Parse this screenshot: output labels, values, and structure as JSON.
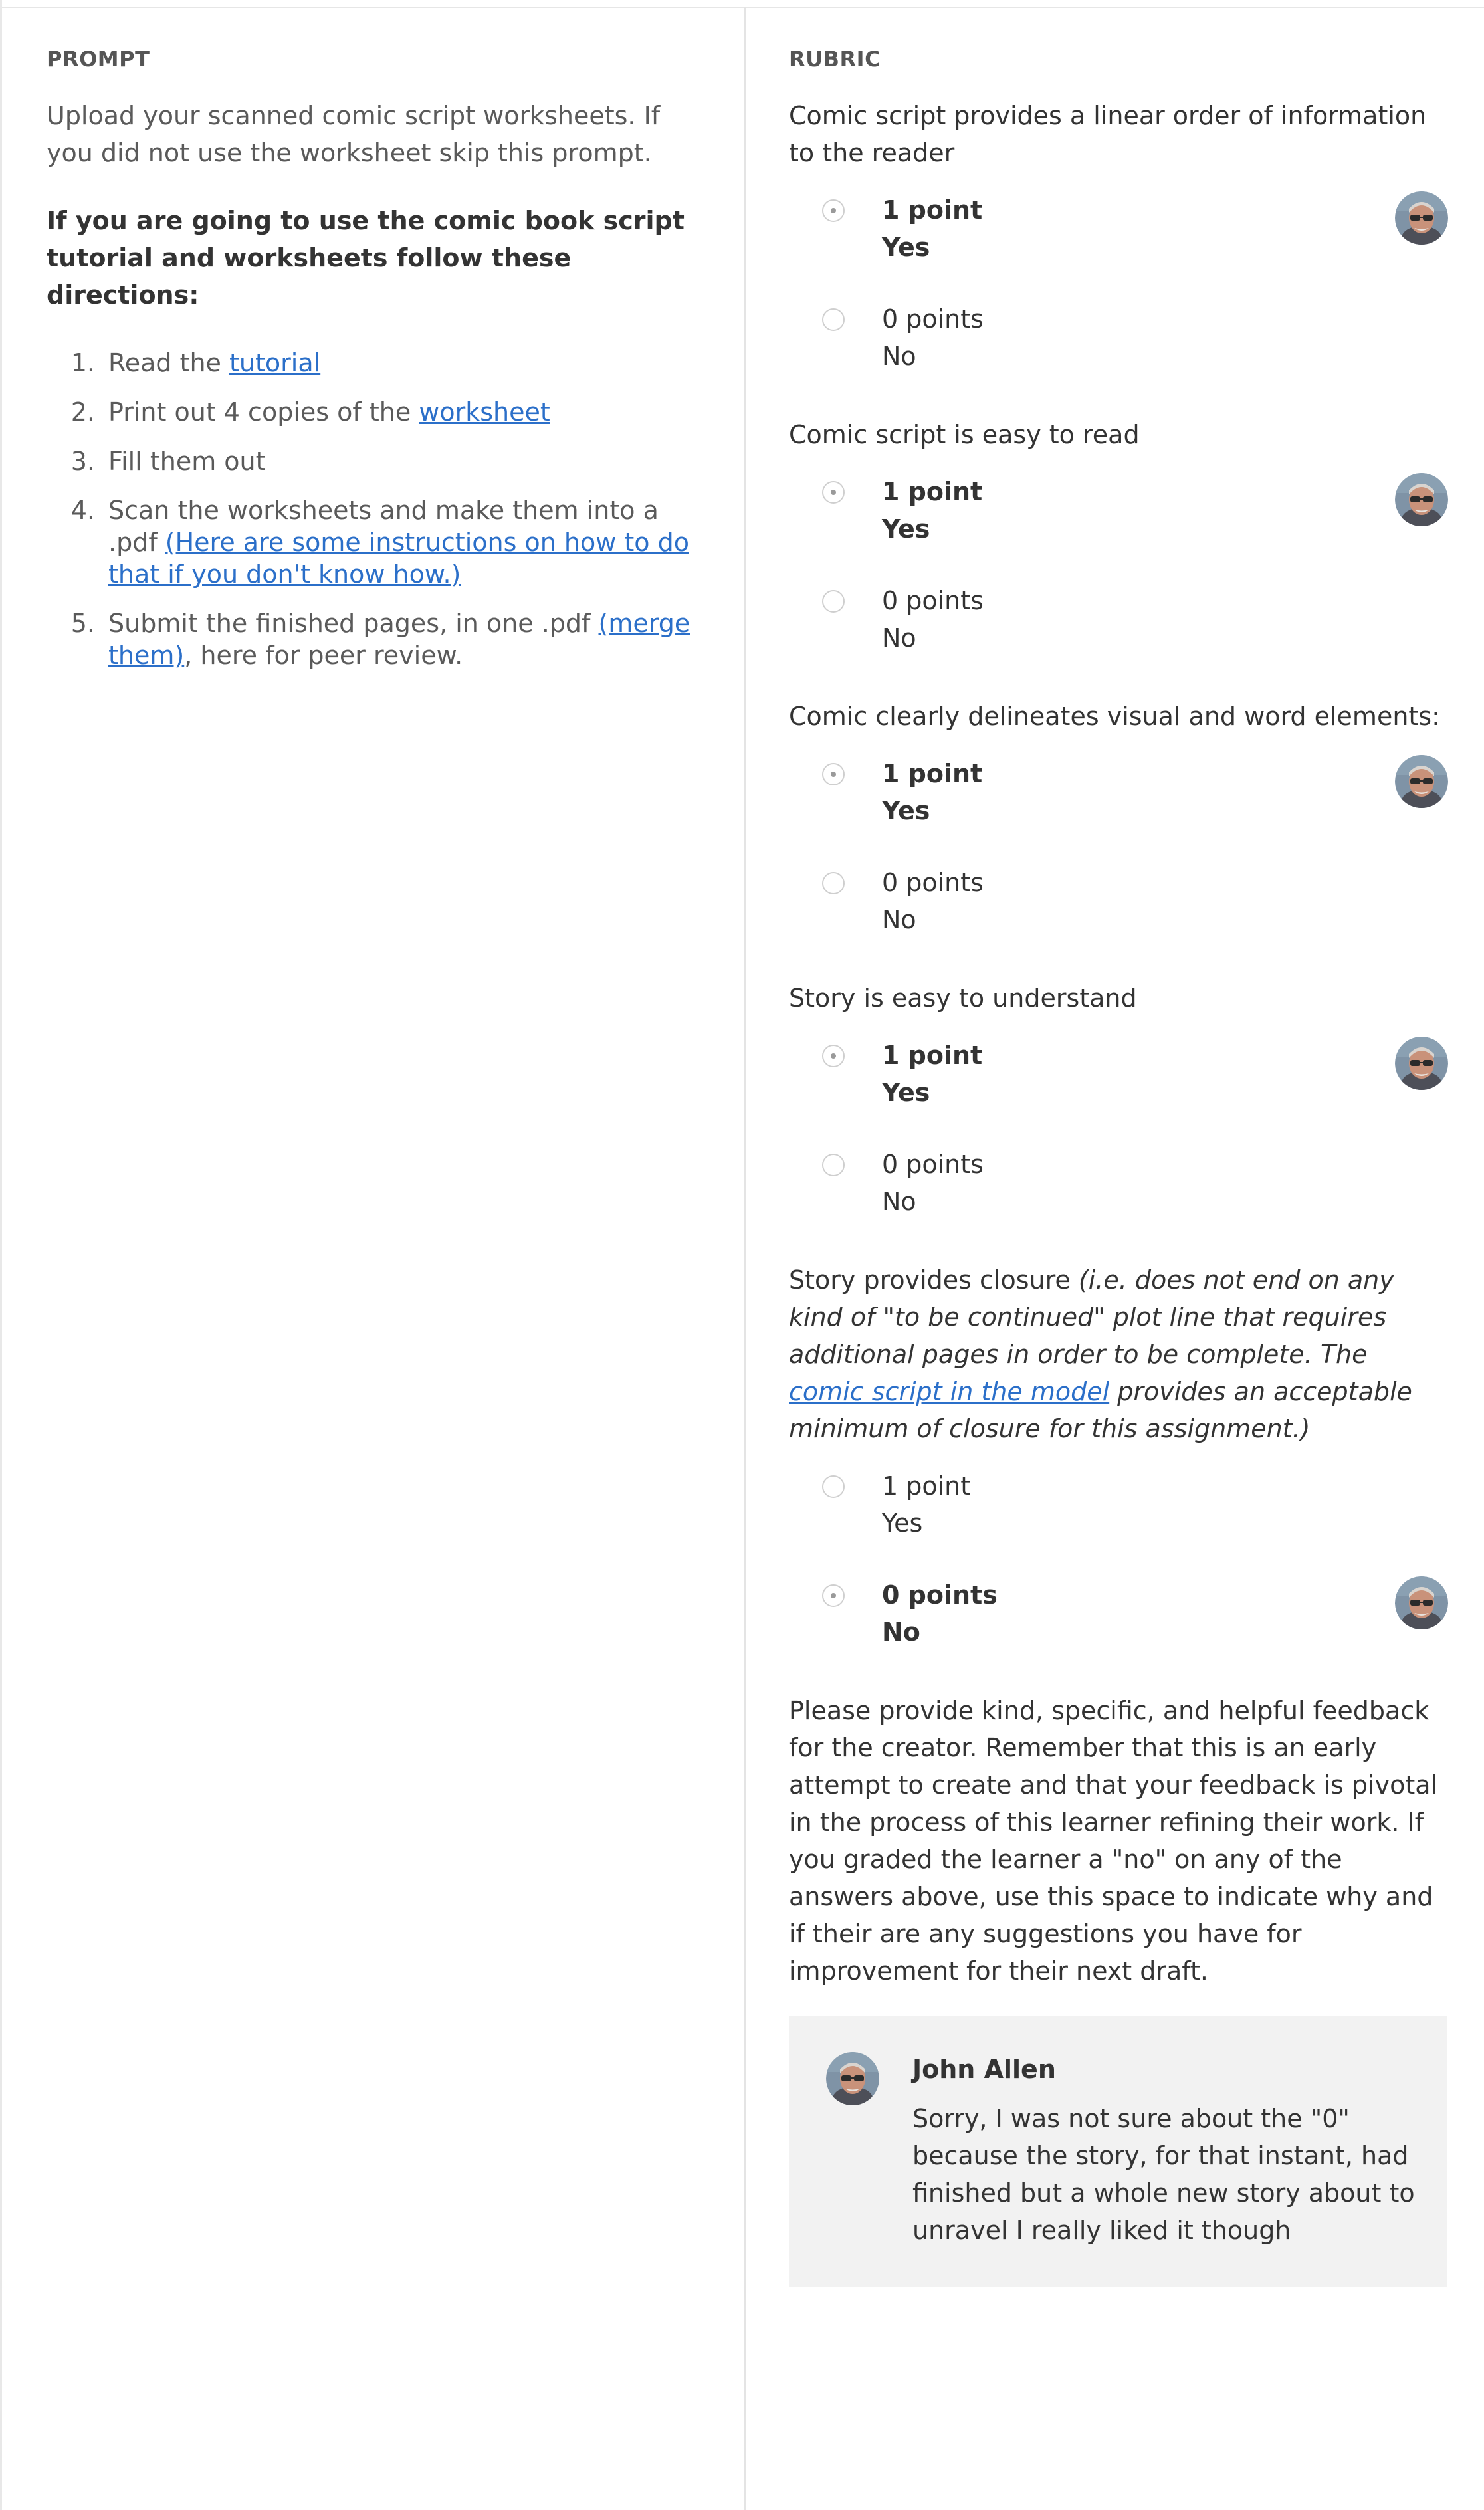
{
  "prompt": {
    "heading": "PROMPT",
    "intro": "Upload your scanned comic script worksheets. If you did not use the worksheet skip this prompt.",
    "directions_heading": "If you are going to use the comic book script tutorial and worksheets follow these directions:",
    "steps": [
      {
        "num": "1.",
        "before": "Read the ",
        "link": "tutorial",
        "after": ""
      },
      {
        "num": "2.",
        "before": "Print out 4 copies of the ",
        "link": "worksheet",
        "after": ""
      },
      {
        "num": "3.",
        "before": "Fill them out",
        "link": "",
        "after": ""
      },
      {
        "num": "4.",
        "before": "Scan the worksheets and make them into a .pdf ",
        "link": "(Here are some instructions on how to do that if you don't know how.)",
        "after": ""
      },
      {
        "num": "5.",
        "before": "Submit the finished pages, in one .pdf ",
        "link": "(merge them)",
        "after": ", here for peer review."
      }
    ]
  },
  "rubric": {
    "heading": "RUBRIC",
    "criteria": [
      {
        "title": "Comic script provides a linear order of information to the reader",
        "options": [
          {
            "points": "1 point",
            "label": "Yes",
            "selected": true
          },
          {
            "points": "0 points",
            "label": "No",
            "selected": false
          }
        ]
      },
      {
        "title": "Comic script is easy to read",
        "options": [
          {
            "points": "1 point",
            "label": "Yes",
            "selected": true
          },
          {
            "points": "0 points",
            "label": "No",
            "selected": false
          }
        ]
      },
      {
        "title": "Comic clearly delineates visual and word elements:",
        "options": [
          {
            "points": "1 point",
            "label": "Yes",
            "selected": true
          },
          {
            "points": "0 points",
            "label": "No",
            "selected": false
          }
        ]
      },
      {
        "title": "Story is easy to understand",
        "options": [
          {
            "points": "1 point",
            "label": "Yes",
            "selected": true
          },
          {
            "points": "0 points",
            "label": "No",
            "selected": false
          }
        ]
      },
      {
        "title_plain": "Story provides closure ",
        "title_italic_1": "(i.e. does not end on any kind of \"to be continued\" plot line that requires additional pages in order to be complete. The ",
        "title_link": "comic script in the model",
        "title_italic_2": " provides an acceptable minimum of closure for this assignment.)",
        "options": [
          {
            "points": "1 point",
            "label": "Yes",
            "selected": false
          },
          {
            "points": "0 points",
            "label": "No",
            "selected": true
          }
        ]
      }
    ],
    "feedback_prompt": "Please provide kind, specific, and helpful feedback for the creator. Remember that this is an early attempt to create and that your feedback is pivotal in the process of this learner refining their work. If you graded the learner a \"no\" on any of the answers above, use this space to indicate why and if their are any suggestions you have for improvement for their next draft.",
    "comment": {
      "author": "John Allen",
      "text": "Sorry, I was not sure about the \"0\" because the story, for that instant, had finished but a whole new story about to unravel I really liked it though"
    }
  },
  "colors": {
    "link": "#2b6fc9",
    "comment_bg": "#f2f2f2",
    "divider": "#e4e4e4"
  },
  "icons": {
    "avatar": "reviewer-avatar-icon"
  }
}
